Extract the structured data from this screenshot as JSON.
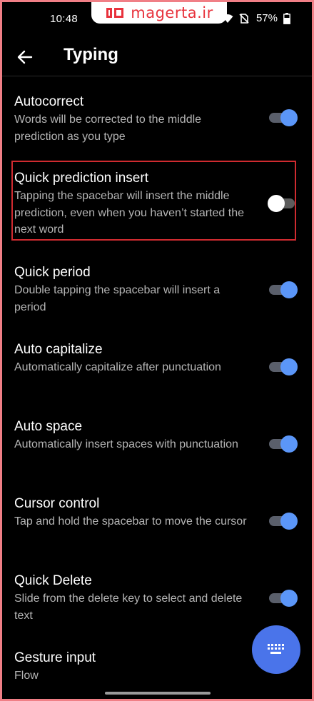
{
  "status_bar": {
    "time": "10:48",
    "battery": "57%",
    "watermark": "magerta.ir"
  },
  "app_bar": {
    "title": "Typing"
  },
  "settings": [
    {
      "title": "Autocorrect",
      "desc": "Words will be corrected to the middle prediction as you type",
      "on": true
    },
    {
      "title": "Quick prediction insert",
      "desc": "Tapping the spacebar will insert the middle prediction, even when you haven’t started the next word",
      "on": false
    },
    {
      "title": "Quick period",
      "desc": "Double tapping the spacebar will insert a period",
      "on": true
    },
    {
      "title": "Auto capitalize",
      "desc": "Automatically capitalize after punctuation",
      "on": true
    },
    {
      "title": "Auto space",
      "desc": "Automatically insert spaces with punctuation",
      "on": true
    },
    {
      "title": "Cursor control",
      "desc": "Tap and hold the spacebar to move the cursor",
      "on": true
    },
    {
      "title": "Quick Delete",
      "desc": "Slide from the delete key to select and delete text",
      "on": true
    },
    {
      "title": "Gesture input",
      "desc": "Flow"
    }
  ],
  "colors": {
    "accent": "#5b96f8",
    "fab": "#4a74ea",
    "highlight": "#d02b30"
  }
}
